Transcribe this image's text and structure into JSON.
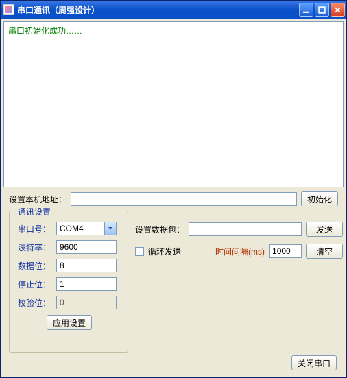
{
  "window": {
    "title": "串口通讯（周强设计）"
  },
  "log": {
    "text": "串口初始化成功……"
  },
  "address": {
    "label": "设置本机地址：",
    "value": "",
    "init_btn": "初始化"
  },
  "comm": {
    "legend": "通讯设置",
    "port_label": "串口号：",
    "port_value": "COM4",
    "baud_label": "波特率：",
    "baud_value": "9600",
    "databits_label": "数据位：",
    "databits_value": "8",
    "stopbits_label": "停止位：",
    "stopbits_value": "1",
    "parity_label": "校验位：",
    "parity_value": "0",
    "apply_btn": "应用设置"
  },
  "packet": {
    "label": "设置数据包：",
    "value": "",
    "send_btn": "发送",
    "loop_label": "循环发送",
    "interval_label": "时间间隔(ms)",
    "interval_value": "1000",
    "clear_btn": "清空"
  },
  "footer": {
    "close_btn": "关闭串口"
  }
}
